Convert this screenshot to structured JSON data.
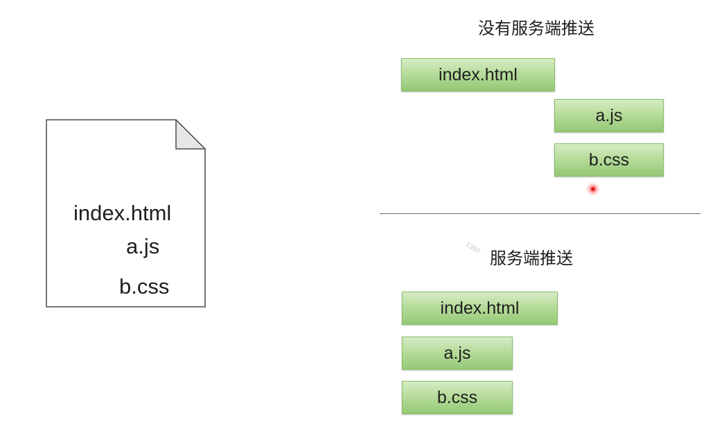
{
  "document": {
    "lines": [
      "index.html",
      "a.js",
      "b.css"
    ]
  },
  "no_push": {
    "title": "没有服务端推送",
    "files": [
      "index.html",
      "a.js",
      "b.css"
    ]
  },
  "push": {
    "title": "服务端推送",
    "files": [
      "index.html",
      "a.js",
      "b.css"
    ]
  },
  "watermark": "1397",
  "colors": {
    "box_fill_top": "#d6ecc4",
    "box_fill_bottom": "#94c976",
    "box_border": "#86bd66",
    "divider": "#6b6b6b",
    "pointer": "#e02020"
  }
}
